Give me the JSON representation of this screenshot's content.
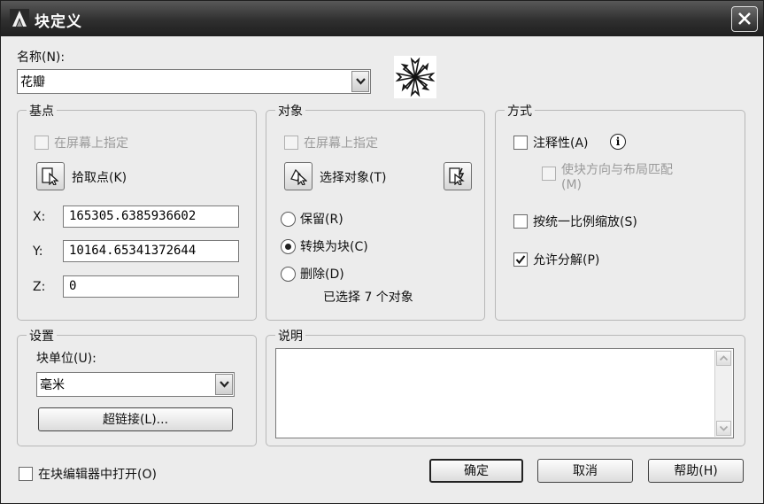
{
  "window": {
    "title": "块定义"
  },
  "name": {
    "label": "名称(N):",
    "value": "花瓣"
  },
  "basepoint": {
    "title": "基点",
    "specify_on_screen": "在屏幕上指定",
    "pick_point": "拾取点(K)",
    "x_label": "X:",
    "x_value": "165305.6385936602",
    "y_label": "Y:",
    "y_value": "10164.65341372644",
    "z_label": "Z:",
    "z_value": "0"
  },
  "objects": {
    "title": "对象",
    "specify_on_screen": "在屏幕上指定",
    "select_objects": "选择对象(T)",
    "retain": "保留(R)",
    "convert": "转换为块(C)",
    "delete": "删除(D)",
    "selected_count": "已选择 7 个对象",
    "selected_option": "convert"
  },
  "behavior": {
    "title": "方式",
    "annotative": "注释性(A)",
    "annotative_checked": false,
    "match_orientation": "使块方向与布局匹配(M)",
    "scale_uniformly": "按统一比例缩放(S)",
    "scale_uniformly_checked": false,
    "allow_exploding": "允许分解(P)",
    "allow_exploding_checked": true
  },
  "settings": {
    "title": "设置",
    "unit_label": "块单位(U):",
    "unit_value": "毫米",
    "hyperlink": "超链接(L)..."
  },
  "description": {
    "title": "说明",
    "value": ""
  },
  "footer": {
    "open_in_editor": "在块编辑器中打开(O)",
    "open_in_editor_checked": false,
    "ok": "确定",
    "cancel": "取消",
    "help": "帮助(H)"
  }
}
